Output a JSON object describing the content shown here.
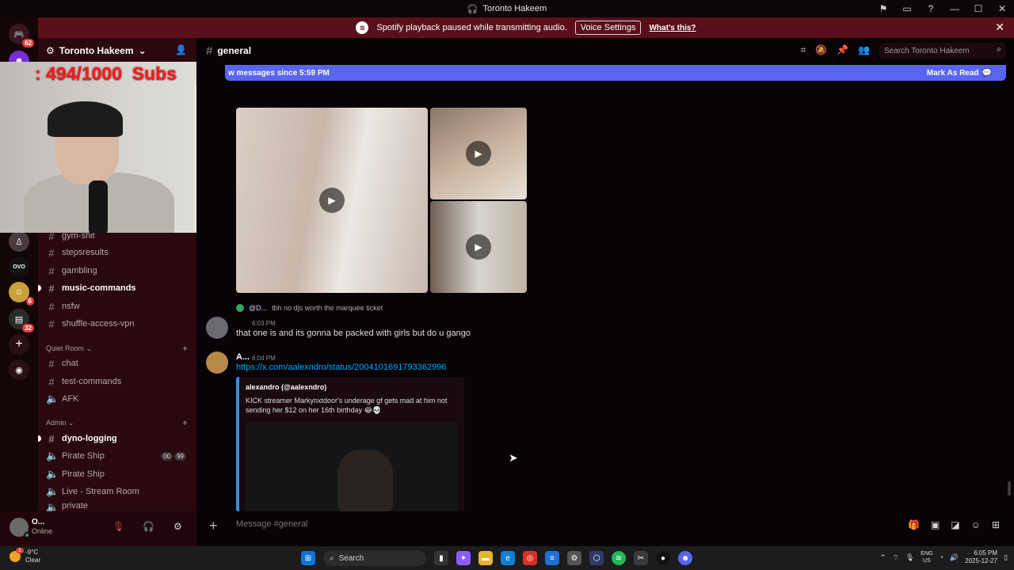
{
  "titlebar": {
    "title": "Toronto Hakeem",
    "buttons": [
      "⚑",
      "▭",
      "?",
      "—",
      "☐",
      "✕"
    ]
  },
  "notice": {
    "text": "Spotify playback paused while transmitting audio.",
    "voice_settings": "Voice Settings",
    "whats_this": "What's this?"
  },
  "rail": {
    "badge_top": "62",
    "badge_mid": "6",
    "badge_bottom": "32",
    "ovo": "OVO"
  },
  "server": {
    "name": "Toronto Hakeem"
  },
  "sidebar": {
    "channels": [
      {
        "name": "gym-shit",
        "type": "text",
        "bold": false
      },
      {
        "name": "stepsresults",
        "type": "text",
        "bold": false
      },
      {
        "name": "gambling",
        "type": "text",
        "bold": false
      },
      {
        "name": "music-commands",
        "type": "text",
        "bold": true
      },
      {
        "name": "nsfw",
        "type": "text",
        "bold": false
      },
      {
        "name": "shuffle-access-vpn",
        "type": "text",
        "bold": false
      }
    ],
    "quiet_room": {
      "label": "Quiet Room",
      "channels": [
        {
          "name": "chat",
          "type": "text"
        },
        {
          "name": "test-commands",
          "type": "text"
        },
        {
          "name": "AFK",
          "type": "voice"
        }
      ]
    },
    "admin": {
      "label": "Admin",
      "channels": [
        {
          "name": "dyno-logging",
          "type": "text",
          "bold": true
        },
        {
          "name": "Pirate Ship",
          "type": "voice",
          "counts": [
            "00",
            "99"
          ]
        },
        {
          "name": "Pirate Ship",
          "type": "voice"
        },
        {
          "name": "Live - Stream Room",
          "type": "voice"
        },
        {
          "name": "private",
          "type": "voice"
        }
      ]
    }
  },
  "user": {
    "name": "O...",
    "status": "Online"
  },
  "stream_overlay": {
    "subs_text": ": 494/1000  Subs"
  },
  "channel": {
    "name": "general"
  },
  "search": {
    "placeholder": "Search Toronto Hakeem"
  },
  "newbar": {
    "text": "w messages since 5:59 PM",
    "mark_read": "Mark As Read"
  },
  "messages": {
    "reply": {
      "mention": "@D...",
      "text": "tbh no djs worth the marquee ticket"
    },
    "m1": {
      "time": "6:03 PM",
      "text": "that one is and its gonna be packed with girls but do u gango"
    },
    "m2": {
      "author": "A...",
      "time": "6:04 PM",
      "link": "https://x.com/aalexndro/status/2004101691793362996",
      "embed_author": "alexandro (@aalexndro)",
      "embed_desc": "KICK streamer Markynxtdoor's underage gf gets mad at him not sending her $12 on her 16th birthday 😂💀"
    }
  },
  "composer": {
    "placeholder": "Message #general"
  },
  "taskbar": {
    "weather_temp": "-9°C",
    "weather_desc": "Clear",
    "weather_badge": "1",
    "search_label": "Search",
    "lang_top": "ENG",
    "lang_bottom": "US",
    "time": "6:05 PM",
    "date": "2025-12-27"
  }
}
